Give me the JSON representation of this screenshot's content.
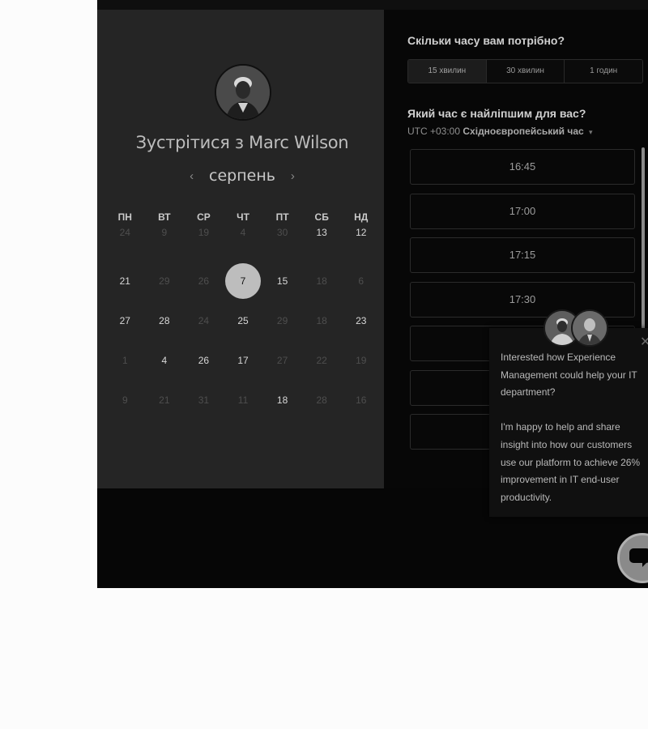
{
  "host": {
    "title": "Зустрітися з Marc Wilson"
  },
  "calendar": {
    "month": "серпень",
    "prev_icon": "‹",
    "next_icon": "›",
    "weekdays": [
      "ПН",
      "ВТ",
      "СР",
      "ЧТ",
      "ПТ",
      "СБ",
      "НД"
    ],
    "rows": [
      [
        {
          "d": "24",
          "on": false
        },
        {
          "d": "9",
          "on": false
        },
        {
          "d": "19",
          "on": false
        },
        {
          "d": "4",
          "on": false
        },
        {
          "d": "30",
          "on": false
        },
        {
          "d": "13",
          "on": true
        },
        {
          "d": "12",
          "on": true
        }
      ],
      [
        {
          "d": "21",
          "on": true
        },
        {
          "d": "29",
          "on": false
        },
        {
          "d": "26",
          "on": false
        },
        {
          "d": "7",
          "on": true,
          "selected": true
        },
        {
          "d": "15",
          "on": true
        },
        {
          "d": "18",
          "on": false
        },
        {
          "d": "6",
          "on": false
        }
      ],
      [
        {
          "d": "27",
          "on": true
        },
        {
          "d": "28",
          "on": true
        },
        {
          "d": "24",
          "on": false
        },
        {
          "d": "25",
          "on": true
        },
        {
          "d": "29",
          "on": false
        },
        {
          "d": "18",
          "on": false
        },
        {
          "d": "23",
          "on": true
        }
      ],
      [
        {
          "d": "1",
          "on": false
        },
        {
          "d": "4",
          "on": true
        },
        {
          "d": "26",
          "on": true
        },
        {
          "d": "17",
          "on": true
        },
        {
          "d": "27",
          "on": false
        },
        {
          "d": "22",
          "on": false
        },
        {
          "d": "19",
          "on": false
        }
      ],
      [
        {
          "d": "9",
          "on": false
        },
        {
          "d": "21",
          "on": false
        },
        {
          "d": "31",
          "on": false
        },
        {
          "d": "11",
          "on": false
        },
        {
          "d": "18",
          "on": true
        },
        {
          "d": "28",
          "on": false
        },
        {
          "d": "16",
          "on": false
        }
      ]
    ]
  },
  "booking": {
    "duration_question": "Скільки часу вам потрібно?",
    "durations": [
      "15 хвилин",
      "30 хвилин",
      "1 годин"
    ],
    "time_question": "Який час є найліпшим для вас?",
    "tz_offset": "UTC +03:00",
    "tz_name": "Східноєвропейський час",
    "tz_caret": "▾",
    "slots": [
      "16:45",
      "17:00",
      "17:15",
      "17:30",
      "",
      "",
      "",
      ""
    ]
  },
  "chat": {
    "close": "✕",
    "paragraph1": "Interested how Experience Management could help your IT department?",
    "paragraph2": "I'm happy to help and share insight into how our customers use our platform to achieve 26% improvement in IT end-user productivity."
  }
}
